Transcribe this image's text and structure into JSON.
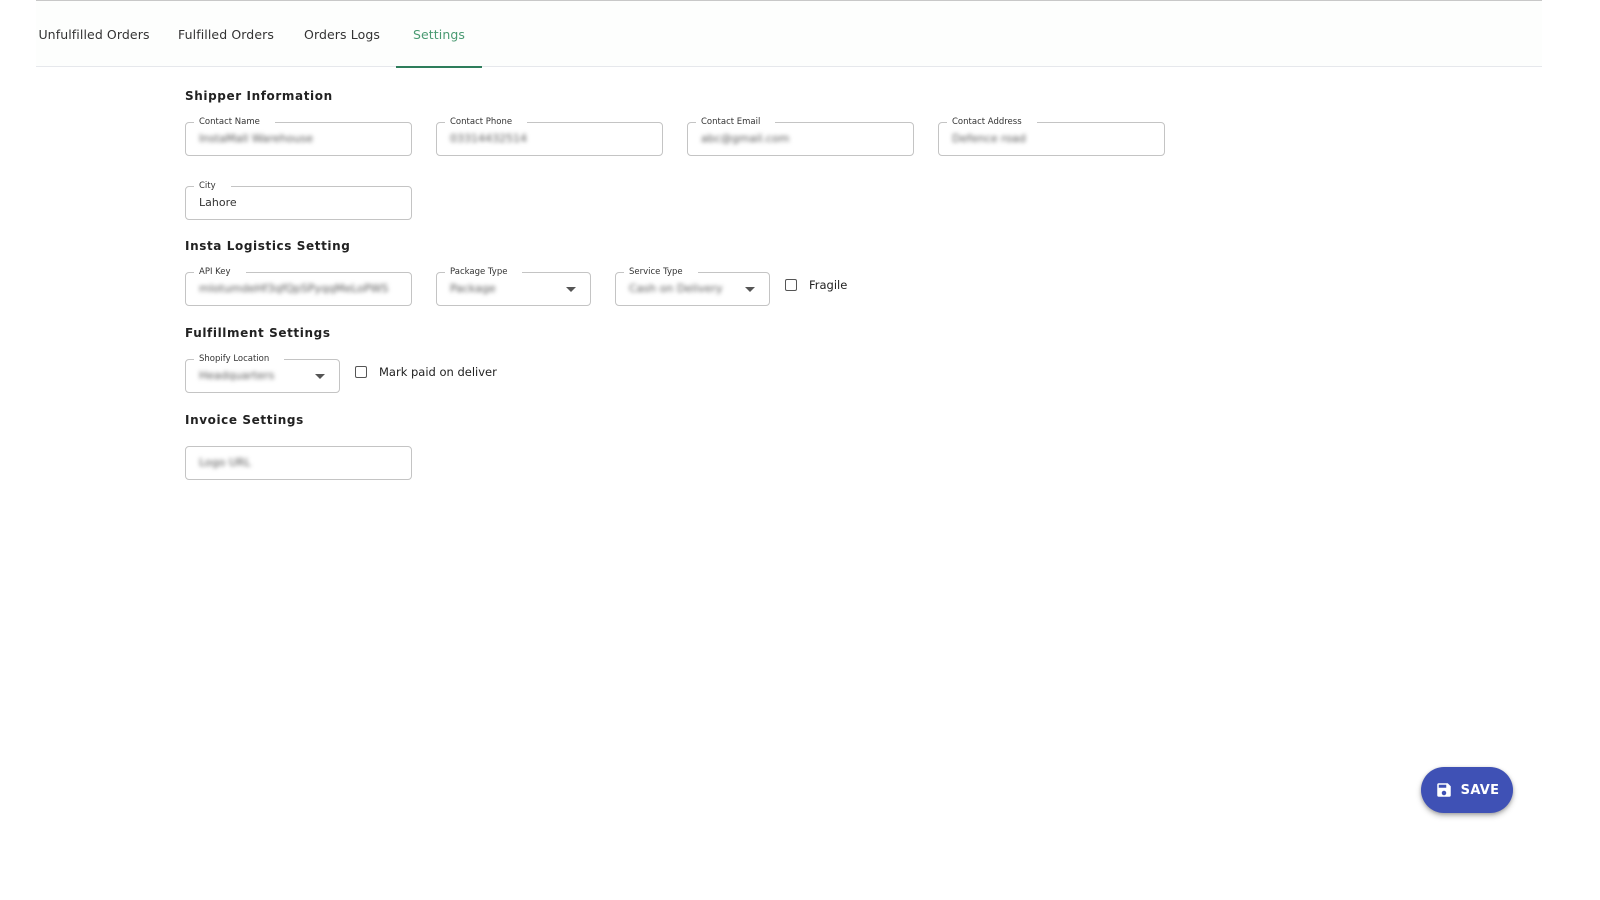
{
  "tabs": [
    {
      "label": "Unfulfilled Orders",
      "active": false
    },
    {
      "label": "Fulfilled Orders",
      "active": false
    },
    {
      "label": "Orders Logs",
      "active": false
    },
    {
      "label": "Settings",
      "active": true
    }
  ],
  "shipper": {
    "title": "Shipper Information",
    "contact_name": {
      "label": "Contact Name",
      "value": "InstaMall Warehouse"
    },
    "contact_phone": {
      "label": "Contact Phone",
      "value": "03314432514"
    },
    "contact_email": {
      "label": "Contact Email",
      "value": "abc@gmail.com"
    },
    "contact_address": {
      "label": "Contact Address",
      "value": "Defence road"
    },
    "city": {
      "label": "City",
      "value": "Lahore"
    }
  },
  "insta_logistics": {
    "title": "Insta Logistics Setting",
    "api_key": {
      "label": "API Key",
      "value": "mlotumdeHf3qfQpSPyqqMeLoPWS"
    },
    "package_type": {
      "label": "Package Type",
      "value": "Package"
    },
    "service_type": {
      "label": "Service Type",
      "value": "Cash on Delivery"
    },
    "fragile": {
      "label": "Fragile",
      "checked": false
    }
  },
  "fulfillment": {
    "title": "Fulfillment Settings",
    "shopify_location": {
      "label": "Shopify Location",
      "value": "Headquarters"
    },
    "mark_paid": {
      "label": "Mark paid on deliver",
      "checked": false
    }
  },
  "invoice": {
    "title": "Invoice Settings",
    "logo_url": {
      "placeholder": "Logo URL",
      "value": "Logo URL"
    }
  },
  "save_button": {
    "label": "SAVE",
    "icon": "floppy-disk-icon",
    "color": "#3f51b5"
  },
  "colors": {
    "active_tab": "#4a9a72",
    "tab_indicator": "#2e7d5b"
  }
}
